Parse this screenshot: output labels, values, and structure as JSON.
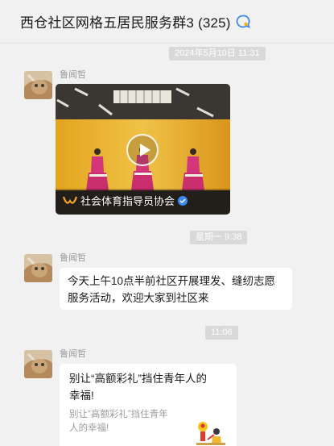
{
  "header": {
    "title": "西仓社区网格五居民服务群3 (325)",
    "icon": "chat-bubble-icon"
  },
  "colors": {
    "background": "#f1f1f1",
    "timestamp_bg": "#d9d9d9",
    "bubble": "#ffffff",
    "accent": "#3d8af5"
  },
  "messages": [
    {
      "timestamp": "2024年5月10日 11:31",
      "sender": "鲁闻哲",
      "type": "video",
      "video_caption": "社会体育指导员协会",
      "icons": [
        "play-icon",
        "channels-logo-icon",
        "verified-badge-icon"
      ]
    },
    {
      "timestamp": "星期一 9:38",
      "sender": "鲁闻哲",
      "type": "text",
      "text_line1": "今天上午10点半前社区开展理发、缝纫志愿",
      "text_line2": "服务活动，欢迎大家到社区来"
    },
    {
      "timestamp": "11:06",
      "sender": "鲁闻哲",
      "type": "link_card",
      "card_title_line1": "别让“高额彩礼”挡住青年人的",
      "card_title_line2": "幸福!",
      "card_desc_line1": "别让“高额彩礼”挡住青年",
      "card_desc_line2": "人的幸福!"
    }
  ]
}
